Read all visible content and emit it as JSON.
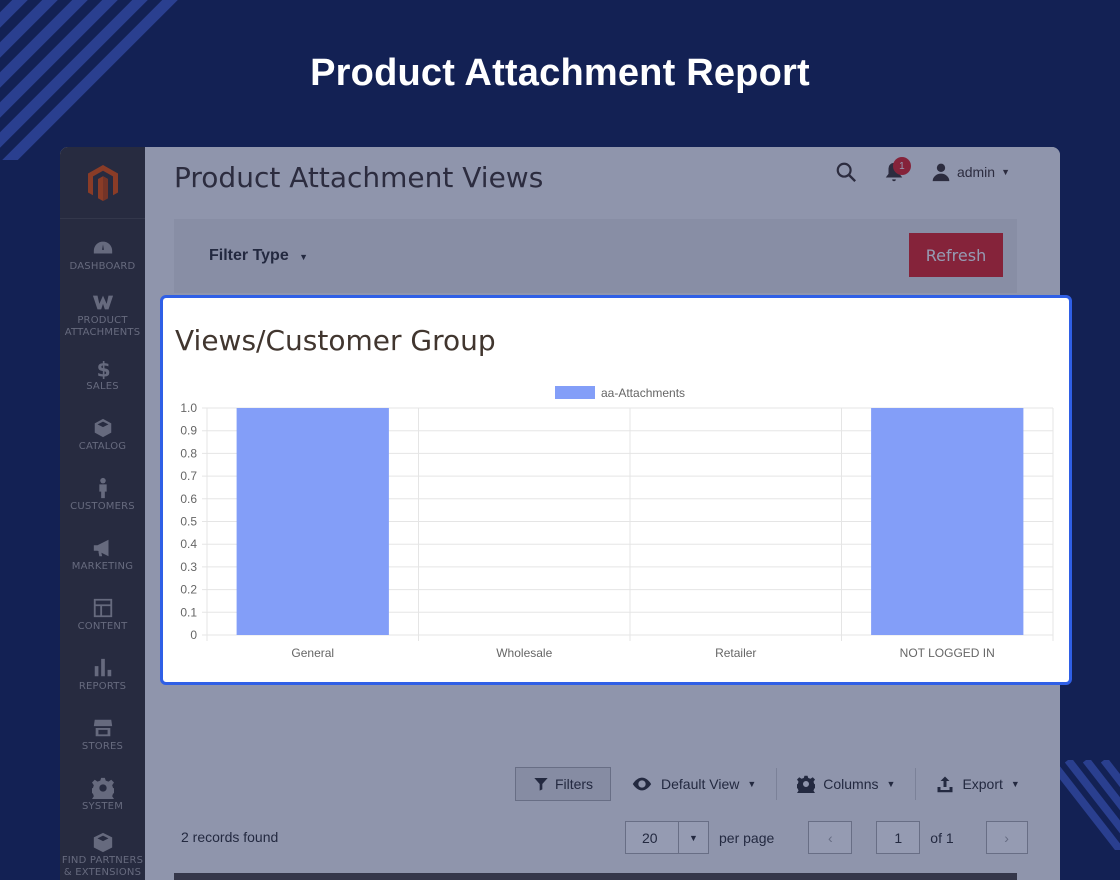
{
  "hero": {
    "title": "Product Attachment Report"
  },
  "sidebar": {
    "items": [
      {
        "label": "DASHBOARD",
        "icon": "dashboard-icon"
      },
      {
        "label": "PRODUCT ATTACHMENTS",
        "icon": "attachments-icon"
      },
      {
        "label": "SALES",
        "icon": "dollar-icon"
      },
      {
        "label": "CATALOG",
        "icon": "cube-icon"
      },
      {
        "label": "CUSTOMERS",
        "icon": "person-icon"
      },
      {
        "label": "MARKETING",
        "icon": "megaphone-icon"
      },
      {
        "label": "CONTENT",
        "icon": "layout-icon"
      },
      {
        "label": "REPORTS",
        "icon": "bar-chart-icon"
      },
      {
        "label": "STORES",
        "icon": "store-icon"
      },
      {
        "label": "SYSTEM",
        "icon": "gear-icon"
      },
      {
        "label": "FIND PARTNERS & EXTENSIONS",
        "icon": "box-icon"
      }
    ]
  },
  "header": {
    "page_title": "Product Attachment Views",
    "notifications_count": "1",
    "user": "admin"
  },
  "filter": {
    "label": "Filter Type",
    "refresh_label": "Refresh"
  },
  "card": {
    "title": "Views/Customer Group"
  },
  "grid": {
    "filters_label": "Filters",
    "view_label": "Default View",
    "columns_label": "Columns",
    "export_label": "Export",
    "records": "2 records found",
    "per_page_value": "20",
    "per_page_label": "per page",
    "page_value": "1",
    "page_total": "of 1"
  },
  "colors": {
    "bar": "#839ef8",
    "accent": "#e22626",
    "highlight": "#2f5fe6",
    "background": "#132154"
  },
  "chart_data": {
    "type": "bar",
    "categories": [
      "General",
      "Wholesale",
      "Retailer",
      "NOT LOGGED IN"
    ],
    "series": [
      {
        "name": "aa-Attachments",
        "values": [
          1,
          0,
          0,
          1
        ]
      }
    ],
    "ylim": [
      0,
      1
    ],
    "yticks": [
      "1.0",
      "0.9",
      "0.8",
      "0.7",
      "0.6",
      "0.5",
      "0.4",
      "0.3",
      "0.2",
      "0.1",
      "0"
    ],
    "legend": "top-center",
    "grid": true
  }
}
